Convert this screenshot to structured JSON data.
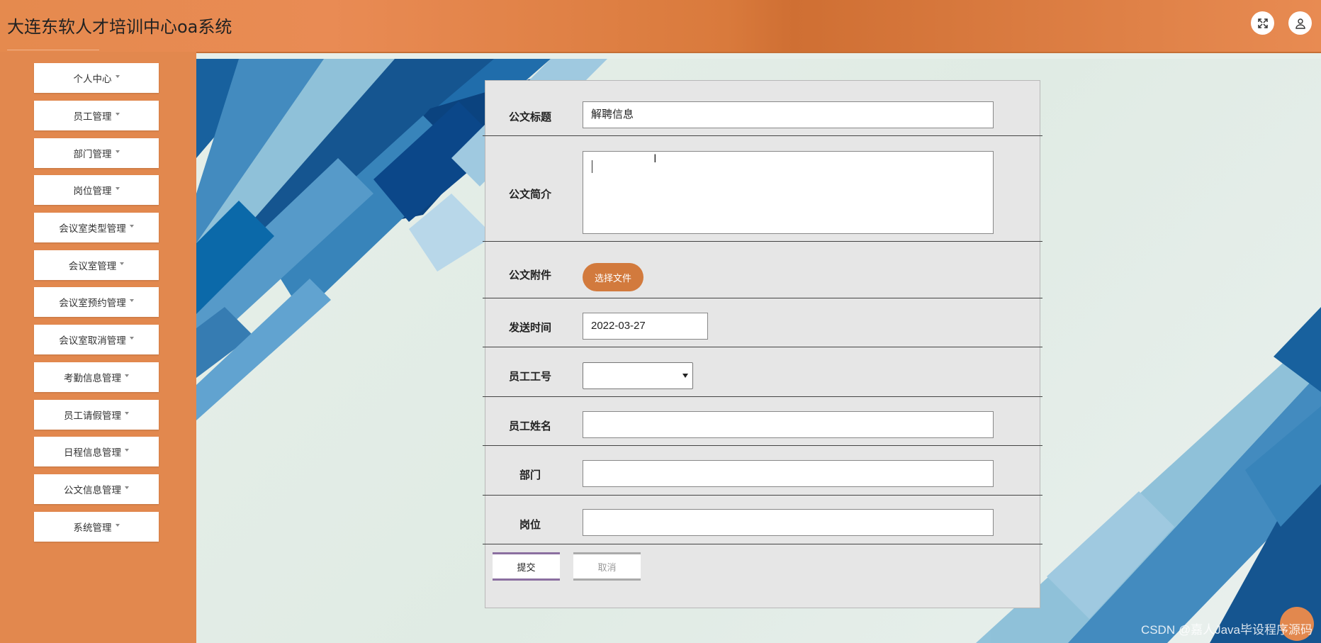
{
  "app": {
    "title": "大连东软人才培训中心oa系统",
    "fullscreen_icon": "fullscreen-icon",
    "user_icon": "user-icon"
  },
  "sidebar": {
    "items": [
      {
        "label": "个人中心"
      },
      {
        "label": "员工管理"
      },
      {
        "label": "部门管理"
      },
      {
        "label": "岗位管理"
      },
      {
        "label": "会议室类型管理"
      },
      {
        "label": "会议室管理"
      },
      {
        "label": "会议室预约管理"
      },
      {
        "label": "会议室取消管理"
      },
      {
        "label": "考勤信息管理"
      },
      {
        "label": "员工请假管理"
      },
      {
        "label": "日程信息管理"
      },
      {
        "label": "公文信息管理"
      },
      {
        "label": "系统管理"
      }
    ]
  },
  "form": {
    "title_label": "公文标题",
    "title_value": "解聘信息",
    "intro_label": "公文简介",
    "intro_value": "",
    "attachment_label": "公文附件",
    "attachment_button": "选择文件",
    "send_time_label": "发送时间",
    "send_time_value": "2022-03-27",
    "emp_no_label": "员工工号",
    "emp_no_value": "",
    "emp_name_label": "员工姓名",
    "emp_name_value": "",
    "dept_label": "部门",
    "dept_value": "",
    "post_label": "岗位",
    "post_value": "",
    "submit_label": "提交",
    "cancel_label": "取消"
  },
  "watermark": "CSDN @嘉人Java毕设程序源码",
  "colors": {
    "accent": "#e2884e",
    "topbar_dark": "#cf6f33",
    "file_button": "#d27a3d",
    "submit_border": "#8b6fa0"
  }
}
